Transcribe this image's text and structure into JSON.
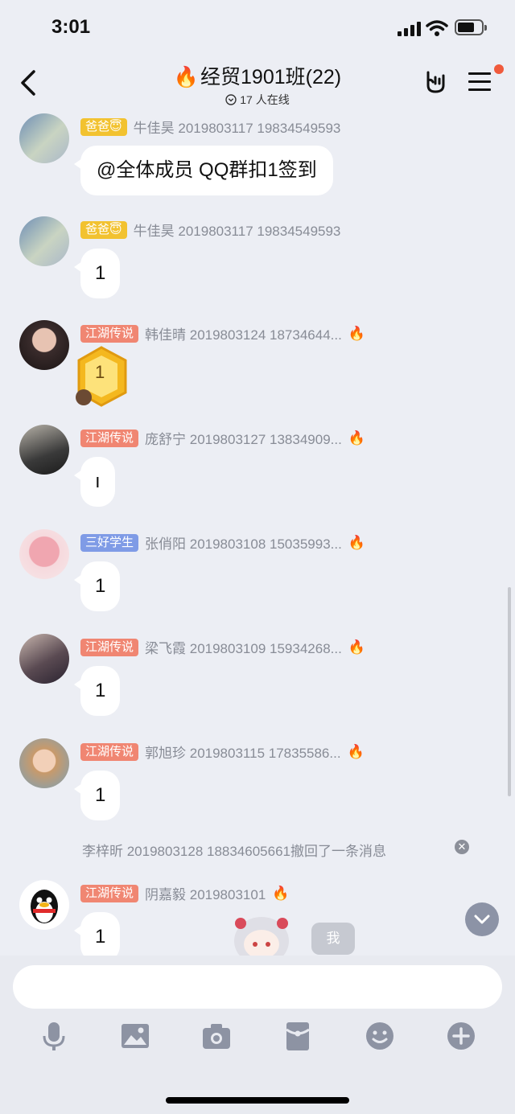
{
  "status": {
    "time": "3:01"
  },
  "header": {
    "title_prefix": "🔥",
    "title": "经贸1901班(22)",
    "online": "17 人在线"
  },
  "messages": [
    {
      "badge": "爸爸",
      "badge_emoji": "😇",
      "badge_color": "#f2c230",
      "sender": "牛佳昊 2019803117 19834549593",
      "fire": "",
      "content": "@全体成员 QQ群扣1签到"
    },
    {
      "badge": "爸爸",
      "badge_emoji": "😇",
      "badge_color": "#f2c230",
      "sender": "牛佳昊 2019803117 19834549593",
      "fire": "",
      "content": "1"
    },
    {
      "badge": "江湖传说",
      "badge_emoji": "",
      "badge_color": "#f08672",
      "sender": "韩佳晴 2019803124 18734644...",
      "fire": "🔥",
      "content": "1"
    },
    {
      "badge": "江湖传说",
      "badge_emoji": "",
      "badge_color": "#f08672",
      "sender": "庞舒宁 2019803127 13834909...",
      "fire": "🔥",
      "content": "ı"
    },
    {
      "badge": "三好学生",
      "badge_emoji": "",
      "badge_color": "#7f9be6",
      "sender": "张俏阳 2019803108 15035993...",
      "fire": "🔥",
      "content": "1"
    },
    {
      "badge": "江湖传说",
      "badge_emoji": "",
      "badge_color": "#f08672",
      "sender": "梁飞霞 2019803109 15934268...",
      "fire": "🔥",
      "content": "1"
    },
    {
      "badge": "江湖传说",
      "badge_emoji": "",
      "badge_color": "#f08672",
      "sender": "郭旭珍 2019803115 17835586...",
      "fire": "🔥",
      "content": "1"
    },
    {
      "badge": "江湖传说",
      "badge_emoji": "",
      "badge_color": "#f08672",
      "sender": "阴嘉毅 2019803101",
      "fire": "🔥",
      "content": "1"
    }
  ],
  "recall_notice": "李梓昕 2019803128 18834605661撤回了一条消息",
  "me_label": "我",
  "input": {
    "placeholder": ""
  },
  "toolbar": [
    "mic-icon",
    "image-icon",
    "camera-icon",
    "red-packet-icon",
    "emoji-icon",
    "plus-icon"
  ]
}
